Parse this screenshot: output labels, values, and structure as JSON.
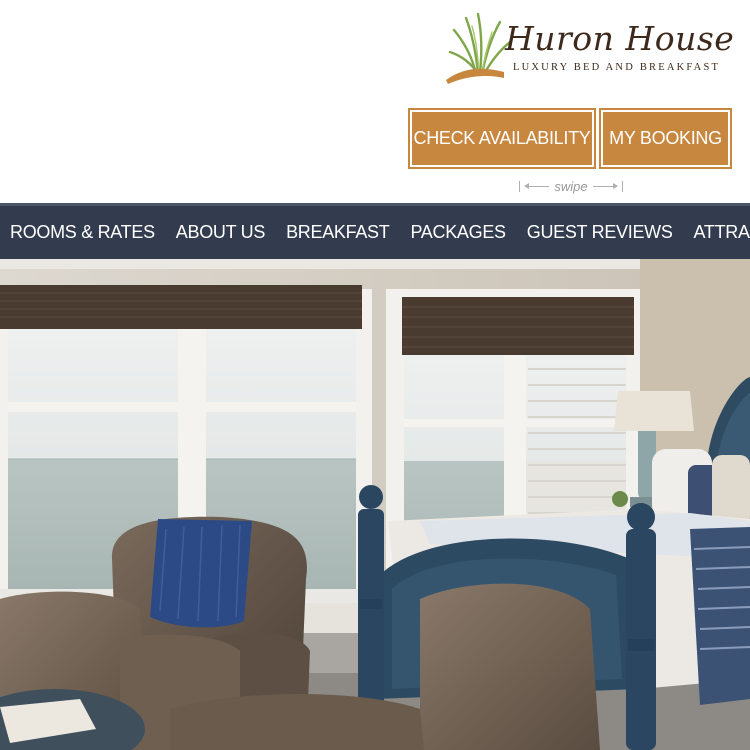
{
  "brand": {
    "name": "Huron House",
    "tagline": "LUXURY BED AND BREAKFAST"
  },
  "actions": {
    "check_availability": "CHECK AVAILABILITY",
    "my_booking": "MY BOOKING"
  },
  "swipe_hint": "swipe",
  "nav": {
    "items": [
      "ROOMS & RATES",
      "ABOUT US",
      "BREAKFAST",
      "PACKAGES",
      "GUEST REVIEWS",
      "ATTRACTIONS"
    ]
  },
  "colors": {
    "accent": "#c8873f",
    "nav_background": "#333b4e",
    "brand_text": "#3d2a1c"
  },
  "hero": {
    "icon": "room-photo"
  }
}
